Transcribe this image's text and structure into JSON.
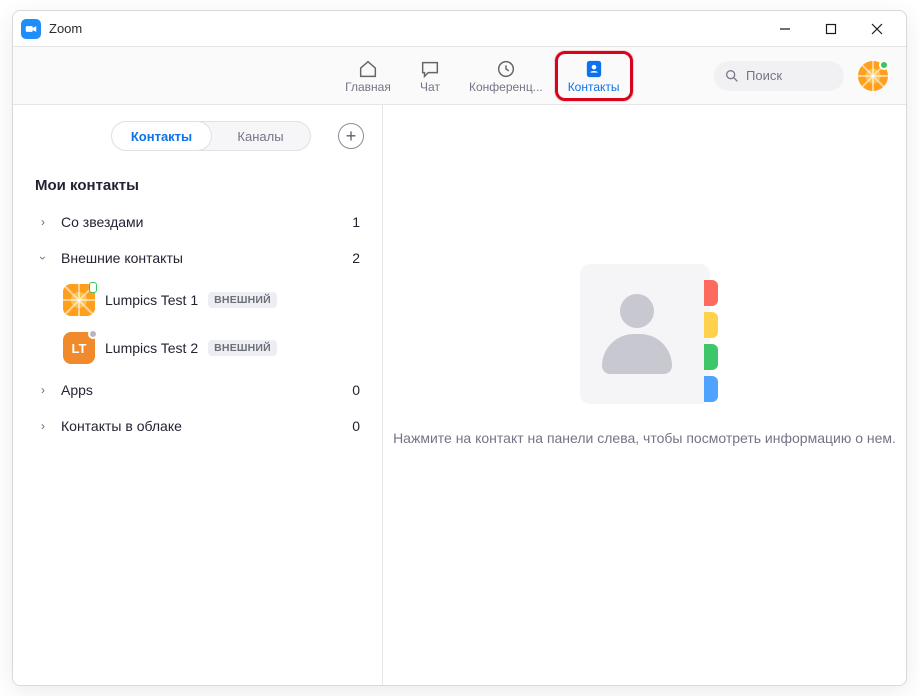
{
  "window": {
    "title": "Zoom"
  },
  "nav": {
    "home": "Главная",
    "chat": "Чат",
    "meetings": "Конференц...",
    "contacts": "Контакты"
  },
  "search": {
    "placeholder": "Поиск"
  },
  "sidebar": {
    "tabs": {
      "contacts": "Контакты",
      "channels": "Каналы"
    },
    "section_title": "Мои контакты",
    "groups": {
      "starred": {
        "label": "Со звездами",
        "count": "1"
      },
      "external": {
        "label": "Внешние контакты",
        "count": "2"
      },
      "apps": {
        "label": "Apps",
        "count": "0"
      },
      "cloud": {
        "label": "Контакты в облаке",
        "count": "0"
      }
    },
    "contacts": [
      {
        "name": "Lumpics Test 1",
        "badge": "ВНЕШНИЙ",
        "initials": ""
      },
      {
        "name": "Lumpics Test 2",
        "badge": "ВНЕШНИЙ",
        "initials": "LT"
      }
    ]
  },
  "main": {
    "hint": "Нажмите на контакт на панели слева, чтобы посмотреть информацию о нем."
  }
}
